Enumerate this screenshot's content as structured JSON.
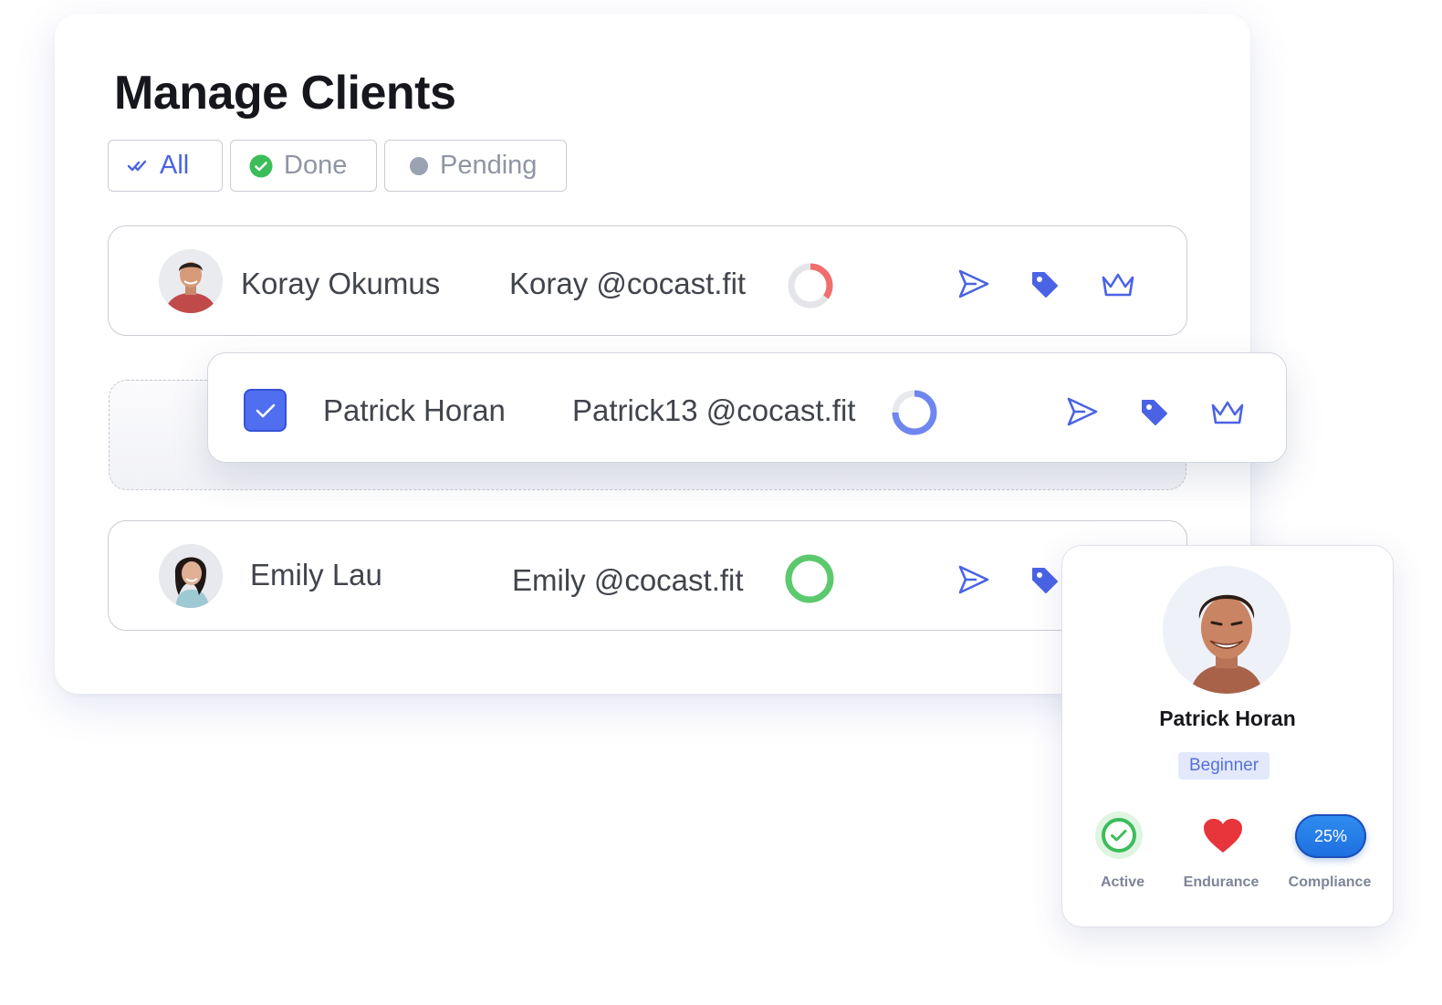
{
  "page": {
    "title": "Manage Clients"
  },
  "filters": [
    {
      "label": "All",
      "icon": "double-check-icon",
      "active": true
    },
    {
      "label": "Done",
      "icon": "check-circle-icon",
      "active": false
    },
    {
      "label": "Pending",
      "icon": "dot-icon",
      "active": false
    }
  ],
  "clients": [
    {
      "name": "Koray Okumus",
      "handle": "Koray @cocast.fit",
      "progress_color": "#f26d6d",
      "progress": 0.35,
      "avatar": "avatar-koray"
    },
    {
      "name": "Patrick Horan",
      "handle": "Patrick13 @cocast.fit",
      "progress_color": "#6f86ee",
      "progress": 0.75,
      "selected": true
    },
    {
      "name": "Emily Lau",
      "handle": "Emily @cocast.fit",
      "progress_color": "#5cc96e",
      "progress": 1.0,
      "avatar": "avatar-emily"
    }
  ],
  "row_actions": [
    "send-icon",
    "tag-icon",
    "crown-icon"
  ],
  "profile": {
    "name": "Patrick Horan",
    "level": "Beginner",
    "stats": {
      "active_label": "Active",
      "endurance_label": "Endurance",
      "compliance_label": "Compliance",
      "compliance_value": "25%"
    }
  },
  "colors": {
    "accent": "#4a63e4",
    "done": "#3cbd5a",
    "pending": "#9aa3b2",
    "heart": "#e8343b",
    "compliance": "#2f8df0"
  }
}
